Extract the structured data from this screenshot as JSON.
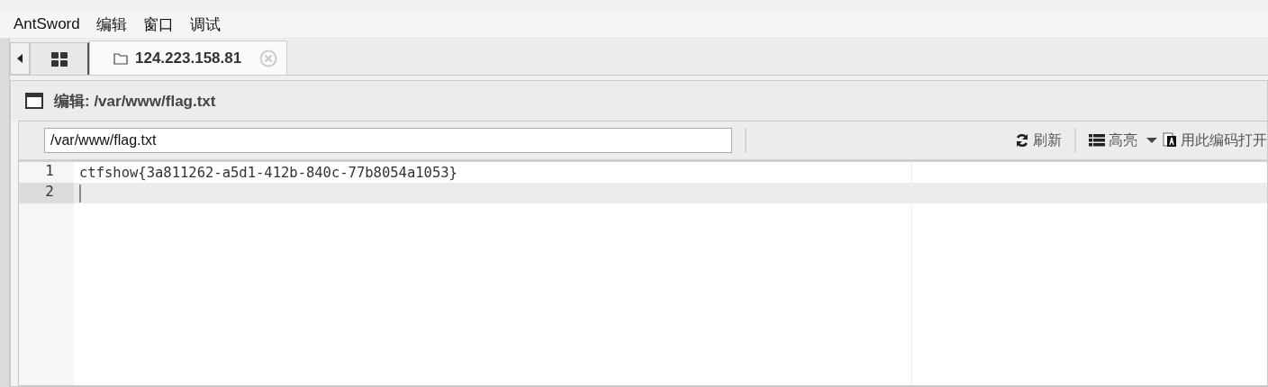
{
  "menu": [
    "AntSword",
    "编辑",
    "窗口",
    "调试"
  ],
  "tabs": [
    {
      "kind": "home",
      "selected": false
    },
    {
      "kind": "host",
      "label": "124.223.158.81",
      "selected": true
    }
  ],
  "panel": {
    "title": "编辑: /var/www/flag.txt"
  },
  "toolbar": {
    "path": "/var/www/flag.txt",
    "refresh": "刷新",
    "highlight": "高亮",
    "encoding": "用此编码打开"
  },
  "editor": {
    "lines": [
      {
        "number": "1",
        "text": "ctfshow{3a811262-a5d1-412b-840c-77b8054a1053}",
        "active": false
      },
      {
        "number": "2",
        "active": true
      }
    ]
  }
}
